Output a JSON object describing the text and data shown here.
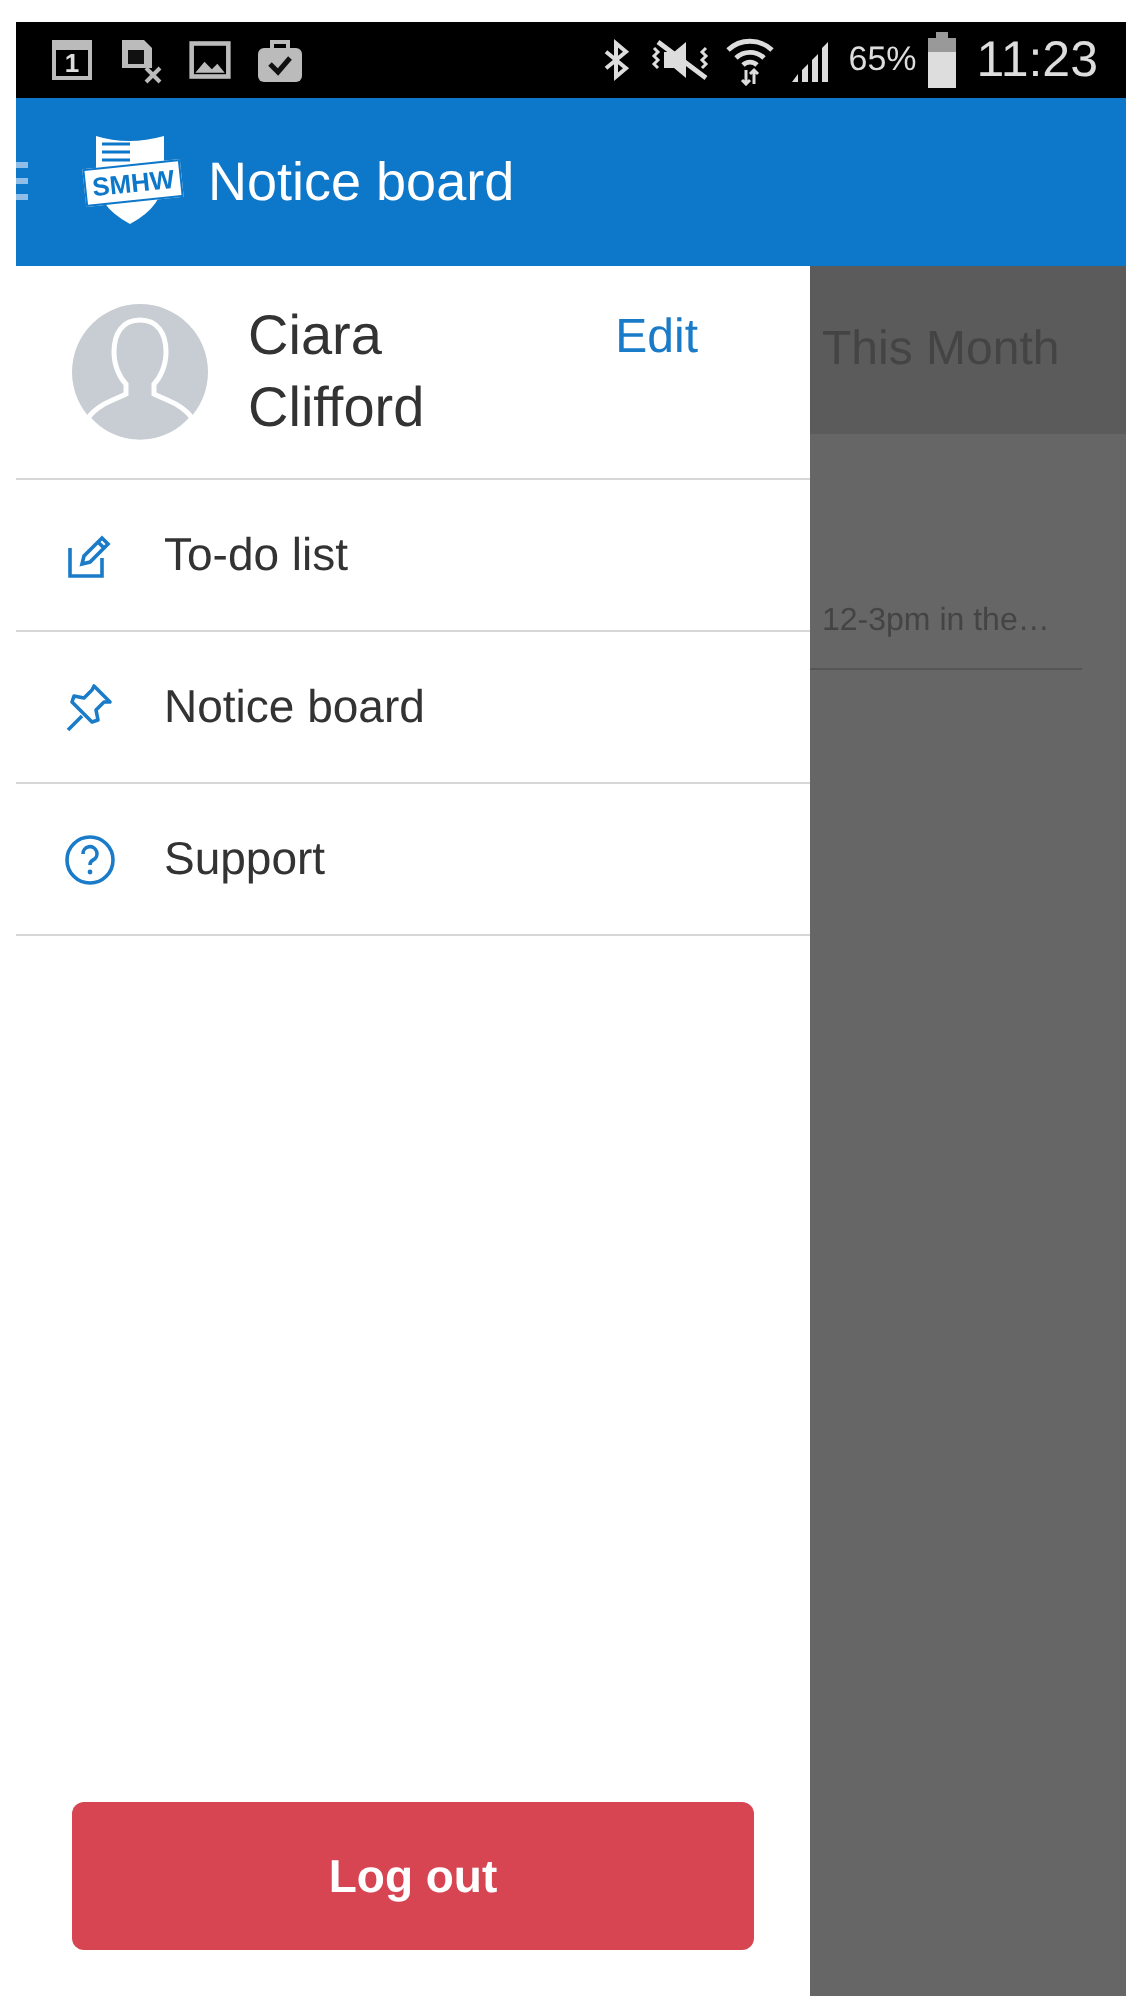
{
  "status_bar": {
    "calendar_day": "1",
    "battery": "65%",
    "time": "11:23"
  },
  "app_bar": {
    "logo_text": "SMHW",
    "title": "Notice board"
  },
  "background": {
    "header": "This Month",
    "row_text": "12-3pm in the…"
  },
  "drawer": {
    "profile": {
      "first_name": "Ciara",
      "last_name": "Clifford",
      "edit": "Edit"
    },
    "items": [
      {
        "kind": "todo",
        "label": "To-do list"
      },
      {
        "kind": "pin",
        "label": "Notice board"
      },
      {
        "kind": "help",
        "label": "Support"
      }
    ],
    "logout": "Log out"
  }
}
